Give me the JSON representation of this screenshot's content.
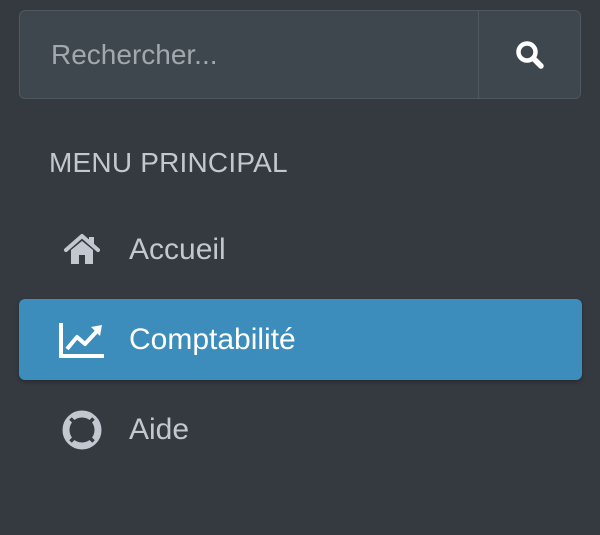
{
  "search": {
    "placeholder": "Rechercher...",
    "value": "",
    "button_icon": "search-icon"
  },
  "menu": {
    "header": "MENU PRINCIPAL",
    "items": [
      {
        "label": "Accueil",
        "icon": "home-icon",
        "active": false
      },
      {
        "label": "Comptabilité",
        "icon": "chart-line-icon",
        "active": true
      },
      {
        "label": "Aide",
        "icon": "life-ring-icon",
        "active": false
      }
    ]
  },
  "colors": {
    "sidebar_bg": "#343a40",
    "active_bg": "#3c8dbc",
    "text": "#c2c7d0",
    "active_text": "#ffffff"
  }
}
